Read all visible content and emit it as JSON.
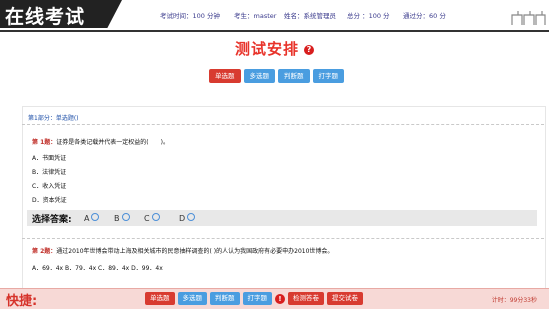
{
  "header": {
    "logo": "在线考试",
    "exam_time": "考试时间：100 分钟",
    "candidate": "考生：master",
    "name": "姓名：系统管理员",
    "total": "总分 ：100 分",
    "pass": "通过分：60 分"
  },
  "title": "测试安排",
  "tabs": [
    "单选题",
    "多选题",
    "判断题",
    "打字题"
  ],
  "section": "第1部分：单选题()",
  "questions": [
    {
      "num": "第 1题：",
      "text": "证券是各类记载并代表一定权益的(　　)。",
      "options": [
        "A．书面凭证",
        "B．法律凭证",
        "C．收入凭证",
        "D．资本凭证"
      ]
    },
    {
      "num": "第 2题：",
      "text": "通过2010年世博会带动上海及相关城市的民意抽样调查的( )的人认为我国政府有必要申办2010世博会。",
      "options": [
        "A．69．4x  B．79．4x  C．89．4x  D．99．4x"
      ]
    }
  ],
  "answer": {
    "label": "选择答案:",
    "options": [
      "A",
      "B",
      "C",
      "D"
    ]
  },
  "bottom": {
    "shortcut": "快捷:",
    "buttons": [
      "单选题",
      "多选题",
      "判断题",
      "打字题"
    ],
    "check": "检测答卷",
    "submit": "提交试卷",
    "timer": "计时：99分33秒"
  }
}
